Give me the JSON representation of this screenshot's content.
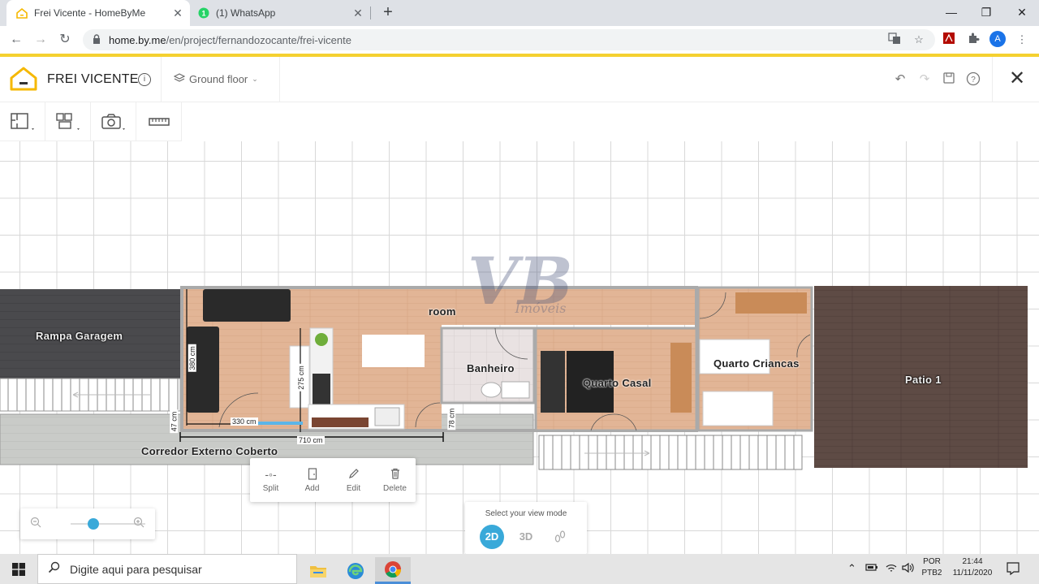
{
  "browser": {
    "tabs": [
      {
        "title": "Frei Vicente - HomeByMe",
        "active": true
      },
      {
        "title": "(1) WhatsApp",
        "active": false,
        "badge": "1"
      }
    ],
    "url_host": "home.by.me",
    "url_path": "/en/project/fernandozocante/frei-vicente",
    "profile_initial": "A"
  },
  "app": {
    "project_title": "FREI VICENTE",
    "floor": "Ground floor",
    "accent_color": "#f5d130"
  },
  "plan": {
    "rooms": [
      {
        "name": "Rampa Garagem"
      },
      {
        "name": "room"
      },
      {
        "name": "Banheiro"
      },
      {
        "name": "Quarto Casal"
      },
      {
        "name": "Quarto Criancas"
      },
      {
        "name": "Patio 1"
      },
      {
        "name": "Corredor Externo Coberto"
      }
    ],
    "dimensions": [
      "380 cm",
      "275 cm",
      "330 cm",
      "47 cm",
      "78 cm",
      "710 cm"
    ]
  },
  "watermark": {
    "main": "VB",
    "sub": "Imóveis"
  },
  "context_menu": {
    "items": [
      {
        "label": "Split",
        "icon": "split-icon"
      },
      {
        "label": "Add",
        "icon": "add-door-icon"
      },
      {
        "label": "Edit",
        "icon": "pencil-icon"
      },
      {
        "label": "Delete",
        "icon": "trash-icon"
      }
    ]
  },
  "view_mode": {
    "label": "Select your view mode",
    "options": [
      "2D",
      "3D"
    ],
    "selected": "2D"
  },
  "zoom": {
    "level": 0.3
  },
  "taskbar": {
    "search_placeholder": "Digite aqui para pesquisar",
    "lang_top": "POR",
    "lang_bottom": "PTB2",
    "time": "21:44",
    "date": "11/11/2020"
  }
}
